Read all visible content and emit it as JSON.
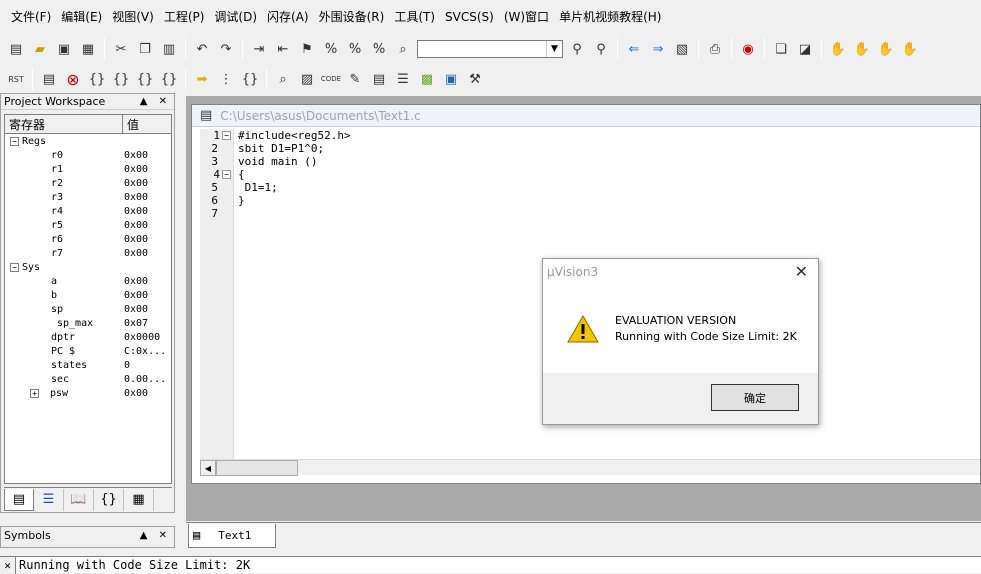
{
  "menu": [
    "文件(F)",
    "编辑(E)",
    "视图(V)",
    "工程(P)",
    "调试(D)",
    "闪存(A)",
    "外围设备(R)",
    "工具(T)",
    "SVCS(S)",
    "(W)窗口",
    "单片机视频教程(H)"
  ],
  "toolbar1_icons": [
    "new-file-icon",
    "open-folder-icon",
    "save-icon",
    "save-all-icon",
    "cut-icon",
    "copy-icon",
    "paste-icon",
    "undo-icon",
    "redo-icon",
    "indent-icon",
    "unindent-icon",
    "bookmark-set-icon",
    "bookmark-prev-icon",
    "bookmark-next-icon",
    "bookmark-clear-icon",
    "find-in-files-icon",
    "find-icon",
    "find-replace-icon",
    "goto-back-icon",
    "goto-forward-icon",
    "browse-icon",
    "print-icon",
    "debug-session-icon",
    "window-cascade-icon",
    "window-tile-icon",
    "hand-icon",
    "hand-stop-icon",
    "hand-mark-icon",
    "hand-flag-icon"
  ],
  "toolbar1_combo": "",
  "toolbar2_icons": [
    "reset-icon",
    "run-to-cursor-icon",
    "stop-icon",
    "step-into-icon",
    "step-over-icon",
    "step-out-icon",
    "run-icon",
    "show-next-icon",
    "disassembly-icon",
    "watch-icon",
    "memory-icon",
    "serial-icon",
    "analyzer-icon",
    "perf-icon",
    "coverage-icon",
    "config-icon",
    "build-hammer-icon"
  ],
  "workspace": {
    "title": "Project Workspace",
    "controls": "▲ ✕",
    "col_reg": "寄存器",
    "col_val": "值",
    "groups": [
      {
        "name": "Regs",
        "rows": [
          [
            "r0",
            "0x00"
          ],
          [
            "r1",
            "0x00"
          ],
          [
            "r2",
            "0x00"
          ],
          [
            "r3",
            "0x00"
          ],
          [
            "r4",
            "0x00"
          ],
          [
            "r5",
            "0x00"
          ],
          [
            "r6",
            "0x00"
          ],
          [
            "r7",
            "0x00"
          ]
        ]
      },
      {
        "name": "Sys",
        "rows": [
          [
            "a",
            "0x00"
          ],
          [
            "b",
            "0x00"
          ],
          [
            "sp",
            "0x00"
          ],
          [
            "sp_max",
            "0x07"
          ],
          [
            "dptr",
            "0x0000"
          ],
          [
            "PC  $",
            "C:0x..."
          ],
          [
            "states",
            "0"
          ],
          [
            "sec",
            "0.00..."
          ],
          [
            "psw",
            "0x00"
          ]
        ]
      }
    ]
  },
  "symbols": {
    "title": "Symbols",
    "controls": "▲ ✕"
  },
  "editor": {
    "title": "C:\\Users\\asus\\Documents\\Text1.c",
    "lines": [
      "#include<reg52.h>",
      "sbit D1=P1^0;",
      "void main ()",
      "{",
      " D1=1;",
      "}",
      ""
    ],
    "line_numbers": [
      "1",
      "2",
      "3",
      "4",
      "5",
      "6",
      "7"
    ]
  },
  "doc_tab": "Text1",
  "output": {
    "close": "✕",
    "text": "Running with Code Size Limit: 2K"
  },
  "dialog": {
    "title": "µVision3",
    "line1": "EVALUATION VERSION",
    "line2": "Running with Code Size Limit: 2K",
    "ok": "确定"
  }
}
